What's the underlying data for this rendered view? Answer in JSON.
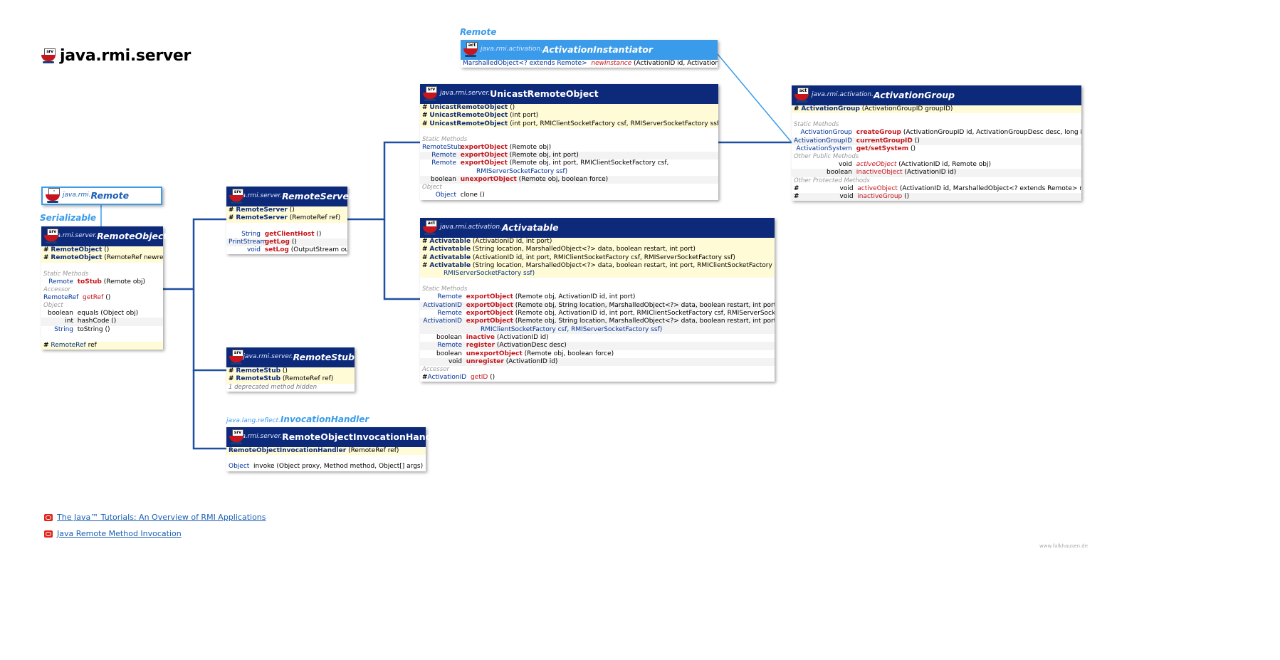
{
  "page": {
    "title": "java.rmi.server",
    "watermark": "www.falkhausen.de"
  },
  "labels": {
    "remote_iface": "Remote",
    "serializable_iface": "Serializable",
    "invocation_pkg": "java.lang.reflect.",
    "invocation_iface": "InvocationHandler"
  },
  "boxes": {
    "remote": {
      "pkg": "java.rmi.",
      "name": "Remote"
    },
    "remote_object": {
      "pkg": "java.rmi.server.",
      "name": "RemoteObject",
      "c1": "RemoteObject",
      "c1a": " ()",
      "c2": "RemoteObject",
      "c2a": " (RemoteRef newref)",
      "sec_static": "Static Methods",
      "sec_accessor": "Accessor",
      "sec_object": "Object",
      "m1t": "Remote",
      "m1n": "toStub",
      "m1a": " (Remote obj)",
      "m2t": "RemoteRef",
      "m2n": "getRef",
      "m2a": " ()",
      "m3t": "boolean",
      "m3n": "equals",
      "m3a": " (Object obj)",
      "m4t": "int",
      "m4n": "hashCode",
      "m4a": " ()",
      "m5t": "String",
      "m5n": "toString",
      "m5a": " ()",
      "f1": "RemoteRef",
      "f1n": " ref"
    },
    "remote_server": {
      "pkg": "java.rmi.server.",
      "name": "RemoteServer",
      "c1": "RemoteServer",
      "c1a": " ()",
      "c2": "RemoteServer",
      "c2a": " (RemoteRef ref)",
      "m1t": "String",
      "m1n": "getClientHost",
      "m1a": " ()",
      "m2t": "PrintStream",
      "m2n": "getLog",
      "m2a": " ()",
      "m3t": "void",
      "m3n": "setLog",
      "m3a": " (OutputStream out)"
    },
    "remote_stub": {
      "pkg": "java.rmi.server.",
      "name": "RemoteStub",
      "c1": "RemoteStub",
      "c1a": " ()",
      "c2": "RemoteStub",
      "c2a": " (RemoteRef ref)",
      "note": "1 deprecated method hidden"
    },
    "roih": {
      "pkg": "java.rmi.server.",
      "name": "RemoteObjectInvocationHandler",
      "c1": "RemoteObjectInvocationHandler",
      "c1a": " (RemoteRef ref)",
      "m1t": "Object",
      "m1n": "invoke",
      "m1a": " (Object proxy, Method method, Object[] args)"
    },
    "activation_instantiator": {
      "pkg": "java.rmi.activation.",
      "name": "ActivationInstantiator",
      "m1": "MarshalledObject<? extends Remote>",
      "m1n": "newInstance",
      "m1a": " (ActivationID id, ActivationDesc desc)"
    },
    "unicast": {
      "pkg": "java.rmi.server.",
      "name": "UnicastRemoteObject",
      "c1": "UnicastRemoteObject",
      "c1a": " ()",
      "c2": "UnicastRemoteObject",
      "c2a": " (int port)",
      "c3": "UnicastRemoteObject",
      "c3a": " (int port, RMIClientSocketFactory csf, RMIServerSocketFactory ssf)",
      "sec_static": "Static Methods",
      "sec_object": "Object",
      "m1t": "RemoteStub",
      "m1n": "exportObject",
      "m1a": " (Remote obj)",
      "m2t": "Remote",
      "m2n": "exportObject",
      "m2a": " (Remote obj, int port)",
      "m3t": "Remote",
      "m3n": "exportObject",
      "m3a": " (Remote obj, int port, RMIClientSocketFactory csf,",
      "m3b": "RMIServerSocketFactory ssf)",
      "m4t": "boolean",
      "m4n": "unexportObject",
      "m4a": " (Remote obj, boolean force)",
      "m5t": "Object",
      "m5n": "clone",
      "m5a": " ()"
    },
    "activatable": {
      "pkg": "java.rmi.activation.",
      "name": "Activatable",
      "c1": "Activatable",
      "c1a": " (ActivationID id, int port)",
      "c2": "Activatable",
      "c2a": " (String location, MarshalledObject<?> data, boolean restart, int port)",
      "c3": "Activatable",
      "c3a": " (ActivationID id, int port, RMIClientSocketFactory csf, RMIServerSocketFactory ssf)",
      "c4": "Activatable",
      "c4a": " (String location, MarshalledObject<?> data, boolean restart, int port, RMIClientSocketFactory csf,",
      "c4b": "RMIServerSocketFactory ssf)",
      "sec_static": "Static Methods",
      "sec_accessor": "Accessor",
      "m1t": "Remote",
      "m1n": "exportObject",
      "m1a": " (Remote obj, ActivationID id, int port)",
      "m2t": "ActivationID",
      "m2n": "exportObject",
      "m2a": " (Remote obj, String location, MarshalledObject<?> data, boolean restart, int port)",
      "m3t": "Remote",
      "m3n": "exportObject",
      "m3a": " (Remote obj, ActivationID id, int port, RMIClientSocketFactory csf, RMIServerSocketFactory ssf)",
      "m4t": "ActivationID",
      "m4n": "exportObject",
      "m4a": " (Remote obj, String location, MarshalledObject<?> data, boolean restart, int port,",
      "m4b": "RMIClientSocketFactory csf, RMIServerSocketFactory ssf)",
      "m5t": "boolean",
      "m5n": "inactive",
      "m5a": " (ActivationID id)",
      "m6t": "Remote",
      "m6n": "register",
      "m6a": " (ActivationDesc desc)",
      "m7t": "boolean",
      "m7n": "unexportObject",
      "m7a": " (Remote obj, boolean force)",
      "m8t": "void",
      "m8n": "unregister",
      "m8a": " (ActivationID id)",
      "m9t": "ActivationID",
      "m9n": "getID",
      "m9a": " ()"
    },
    "activation_group": {
      "pkg": "java.rmi.activation.",
      "name": "ActivationGroup",
      "c1": "ActivationGroup",
      "c1a": " (ActivationGroupID groupID)",
      "sec_static": "Static Methods",
      "sec_public": "Other Public Methods",
      "sec_protected": "Other Protected Methods",
      "m1t": "ActivationGroup",
      "m1n": "createGroup",
      "m1a": " (ActivationGroupID id, ActivationGroupDesc desc, long incarnation)",
      "m2t": "ActivationGroupID",
      "m2n": "currentGroupID",
      "m2a": " ()",
      "m3t": "ActivationSystem",
      "m3n": "get/setSystem",
      "m3a": " ()",
      "m4t": "void",
      "m4n": "activeObject",
      "m4a": " (ActivationID id, Remote obj)",
      "m5t": "boolean",
      "m5n": "inactiveObject",
      "m5a": " (ActivationID id)",
      "m6t": "void",
      "m6n": "activeObject",
      "m6a": " (ActivationID id, MarshalledObject<? extends Remote> mobj)",
      "m7t": "void",
      "m7n": "inactiveGroup",
      "m7a": " ()"
    }
  },
  "footer": {
    "link1": "The Java™ Tutorials: An Overview of RMI Applications",
    "link2": "Java Remote Method Invocation"
  },
  "colors": {
    "header": "#0d2a7a",
    "interface_header": "#3a9bea",
    "method": "#c4161c",
    "type": "#003399",
    "constructor_bg": "#fffbd6"
  }
}
